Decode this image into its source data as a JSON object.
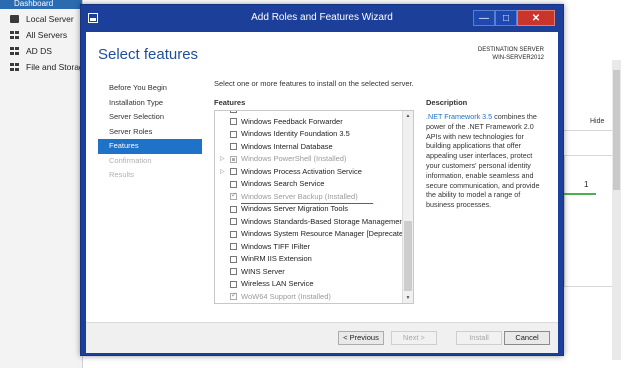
{
  "background": {
    "sidebar": {
      "dashboard": "Dashboard",
      "items": [
        "Local Server",
        "All Servers",
        "AD DS",
        "File and Storage Services"
      ]
    },
    "right": {
      "hide_label": "Hide",
      "count": "1"
    }
  },
  "wizard": {
    "title": "Add Roles and Features Wizard",
    "window_buttons": {
      "minimize": "—",
      "maximize": "□",
      "close": "✕"
    },
    "page_title": "Select features",
    "destination": {
      "label": "DESTINATION SERVER",
      "server": "WIN-SERVER2012"
    },
    "nav": [
      {
        "label": "Before You Begin",
        "state": "normal"
      },
      {
        "label": "Installation Type",
        "state": "normal"
      },
      {
        "label": "Server Selection",
        "state": "normal"
      },
      {
        "label": "Server Roles",
        "state": "normal"
      },
      {
        "label": "Features",
        "state": "active"
      },
      {
        "label": "Confirmation",
        "state": "disabled"
      },
      {
        "label": "Results",
        "state": "disabled"
      }
    ],
    "instruction": "Select one or more features to install on the selected server.",
    "features_header": "Features",
    "description_header": "Description",
    "features": [
      {
        "label": "Windows Biometric Framework",
        "state": "unchecked"
      },
      {
        "label": "Windows Feedback Forwarder",
        "state": "unchecked"
      },
      {
        "label": "Windows Identity Foundation 3.5",
        "state": "unchecked"
      },
      {
        "label": "Windows Internal Database",
        "state": "unchecked"
      },
      {
        "label": "Windows PowerShell (Installed)",
        "state": "partial",
        "expand": true,
        "dim": true
      },
      {
        "label": "Windows Process Activation Service",
        "state": "unchecked",
        "expand": true
      },
      {
        "label": "Windows Search Service",
        "state": "unchecked"
      },
      {
        "label": "Windows Server Backup (Installed)",
        "state": "checked",
        "dim": true,
        "highlight": true
      },
      {
        "label": "Windows Server Migration Tools",
        "state": "unchecked"
      },
      {
        "label": "Windows Standards-Based Storage Management",
        "state": "unchecked"
      },
      {
        "label": "Windows System Resource Manager [Deprecated]",
        "state": "unchecked"
      },
      {
        "label": "Windows TIFF IFilter",
        "state": "unchecked"
      },
      {
        "label": "WinRM IIS Extension",
        "state": "unchecked"
      },
      {
        "label": "WINS Server",
        "state": "unchecked"
      },
      {
        "label": "Wireless LAN Service",
        "state": "unchecked"
      },
      {
        "label": "WoW64 Support (Installed)",
        "state": "checked",
        "dim": true
      }
    ],
    "description": {
      "link": ".NET Framework 3.5",
      "text": " combines the power of the .NET Framework 2.0 APIs with new technologies for building applications that offer appealing user interfaces, protect your customers' personal identity information, enable seamless and secure communication, and provide the ability to model a range of business processes."
    },
    "buttons": {
      "previous": "< Previous",
      "next": "Next >",
      "install": "Install",
      "cancel": "Cancel"
    },
    "colors": {
      "titlebar": "#1c3f9a",
      "accent": "#1e72c8",
      "close": "#c9352b",
      "highlight_underline": "#e02a2a"
    }
  }
}
